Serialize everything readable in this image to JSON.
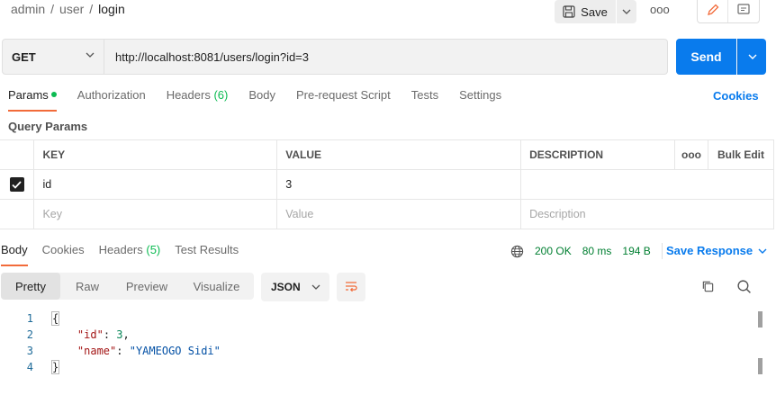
{
  "breadcrumb": {
    "items": [
      "admin",
      "user"
    ],
    "separator": "/",
    "current": "login"
  },
  "toolbar": {
    "save_label": "Save",
    "more_label": "ooo"
  },
  "request": {
    "method": "GET",
    "url": "http://localhost:8081/users/login?id=3",
    "send_label": "Send"
  },
  "request_tabs": {
    "params": "Params",
    "authorization": "Authorization",
    "headers": "Headers",
    "headers_count": "(6)",
    "body": "Body",
    "pre_request": "Pre-request Script",
    "tests": "Tests",
    "settings": "Settings",
    "cookies": "Cookies"
  },
  "query_params": {
    "title": "Query Params",
    "columns": {
      "key": "KEY",
      "value": "VALUE",
      "description": "DESCRIPTION",
      "more": "ooo",
      "bulk_edit": "Bulk Edit"
    },
    "rows": [
      {
        "key": "id",
        "value": "3",
        "description": "",
        "checked": true
      }
    ],
    "placeholders": {
      "key": "Key",
      "value": "Value",
      "description": "Description"
    }
  },
  "response_tabs": {
    "body": "Body",
    "cookies": "Cookies",
    "headers": "Headers",
    "headers_count": "(5)",
    "test_results": "Test Results"
  },
  "response_status": {
    "status": "200 OK",
    "time": "80 ms",
    "size": "194 B",
    "save_response": "Save Response"
  },
  "view_tabs": {
    "pretty": "Pretty",
    "raw": "Raw",
    "preview": "Preview",
    "visualize": "Visualize",
    "format": "JSON"
  },
  "code": {
    "line_numbers": [
      "1",
      "2",
      "3",
      "4"
    ],
    "open_brace": "{",
    "close_brace": "}",
    "entries": [
      {
        "key": "\"id\"",
        "colon": ": ",
        "value": "3",
        "trail": ","
      },
      {
        "key": "\"name\"",
        "colon": ": ",
        "value": "\"YAMEOGO Sidi\"",
        "trail": ""
      }
    ]
  },
  "colors": {
    "accent": "#097bed",
    "tab_underline": "#f26b3a",
    "success": "#007f31",
    "dot": "#0cbb52"
  }
}
